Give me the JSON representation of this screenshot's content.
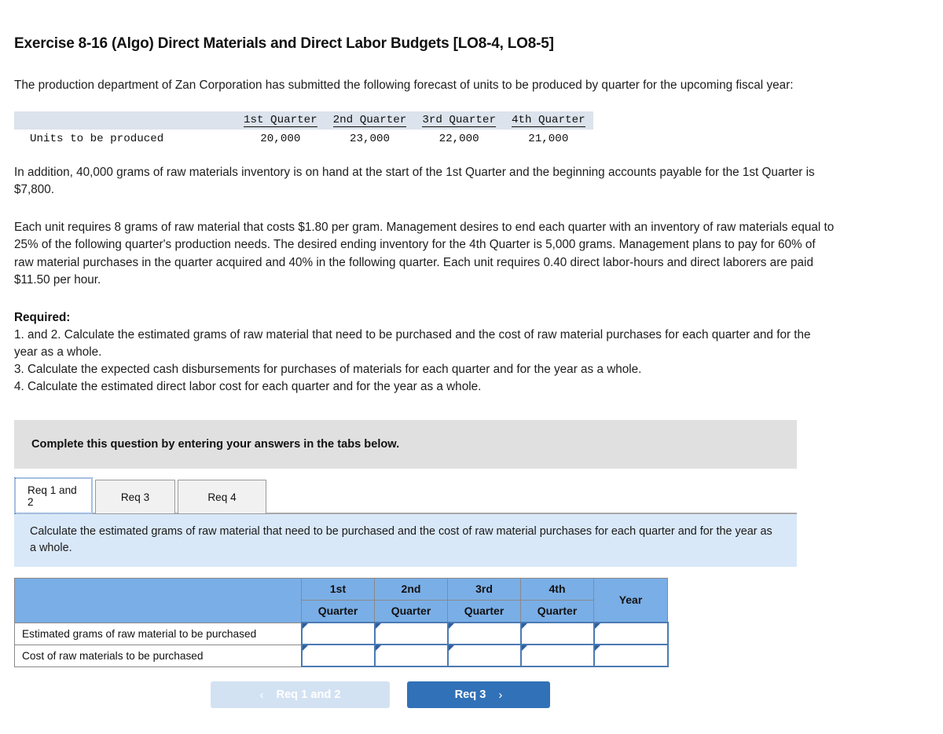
{
  "title": "Exercise 8-16 (Algo) Direct Materials and Direct Labor Budgets [LO8-4, LO8-5]",
  "intro": {
    "paragraph1": "The production department of Zan Corporation has submitted the following forecast of units to be produced by quarter for the upcoming fiscal year:",
    "paragraph2": "In addition, 40,000 grams of raw materials inventory is on hand at the start of the 1st Quarter and the beginning accounts payable for the 1st Quarter is $7,800.",
    "paragraph3": "Each unit requires 8 grams of raw material that costs $1.80 per gram. Management desires to end each quarter with an inventory of raw materials equal to 25% of the following quarter's production needs. The desired ending inventory for the 4th Quarter is 5,000 grams. Management plans to pay for 60% of raw material purchases in the quarter acquired and 40% in the following quarter. Each unit requires 0.40 direct labor-hours and direct laborers are paid $11.50 per hour."
  },
  "forecast_table": {
    "headers": [
      "1st Quarter",
      "2nd Quarter",
      "3rd Quarter",
      "4th Quarter"
    ],
    "row_label": "Units to be produced",
    "values": [
      "20,000",
      "23,000",
      "22,000",
      "21,000"
    ]
  },
  "required": {
    "heading": "Required:",
    "items": [
      "1. and 2. Calculate the estimated grams of raw material that need to be purchased and the cost of raw material purchases for each quarter and for the year as a whole.",
      "3. Calculate the expected cash disbursements for purchases of materials for each quarter and for the year as a whole.",
      "4. Calculate the estimated direct labor cost for each quarter and for the year as a whole."
    ]
  },
  "banner": {
    "text": "Complete this question by entering your answers in the tabs below."
  },
  "tabs": [
    {
      "label": "Req 1 and 2",
      "active": true
    },
    {
      "label": "Req 3",
      "active": false
    },
    {
      "label": "Req 4",
      "active": false
    }
  ],
  "blue_panel": {
    "text": "Calculate the estimated grams of raw material that need to be purchased and the cost of raw material purchases for each quarter and for the year as a whole."
  },
  "answer_table": {
    "column_headers_top": [
      "1st",
      "2nd",
      "3rd",
      "4th"
    ],
    "column_headers_bottom": [
      "Quarter",
      "Quarter",
      "Quarter",
      "Quarter"
    ],
    "year_header": "Year",
    "rows": [
      {
        "label": "Estimated grams of raw material to be purchased",
        "cells": [
          "",
          "",
          "",
          "",
          ""
        ]
      },
      {
        "label": "Cost of raw materials to be purchased",
        "cells": [
          "",
          "",
          "",
          "",
          ""
        ]
      }
    ]
  },
  "nav": {
    "prev_label": "Req 1 and 2",
    "prev_chevron": "‹",
    "next_label": "Req 3",
    "next_chevron": "›"
  },
  "colors": {
    "header_blue": "#7aaee6",
    "panel_blue": "#d9e8f8",
    "banner_gray": "#e0e0e0",
    "button_blue": "#3171b8",
    "button_disabled": "#d3e2f2",
    "cell_border_blue": "#4a7ab3",
    "forecast_header_bg": "#dce3ec"
  }
}
